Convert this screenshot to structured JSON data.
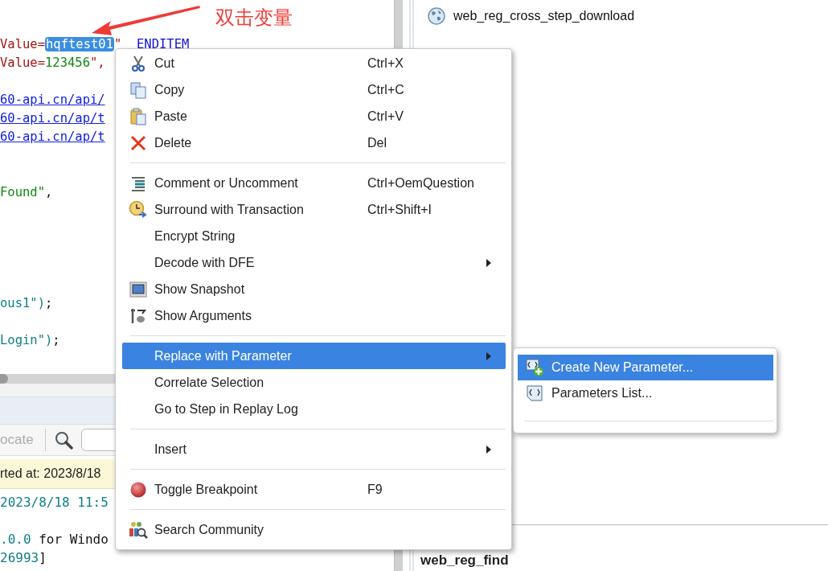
{
  "annotation": {
    "label": "双击变量"
  },
  "editor": {
    "lines": [
      {
        "kind": "code",
        "segments": [
          {
            "kind": "attr",
            "text": "Value="
          },
          {
            "kind": "selected",
            "text": "hqftest01"
          },
          {
            "kind": "attr",
            "text": "\"  "
          },
          {
            "kind": "keyword",
            "text": "ENDITEM"
          }
        ]
      },
      {
        "kind": "code",
        "segments": [
          {
            "kind": "attr",
            "text": "Value="
          },
          {
            "kind": "string",
            "text": "123456"
          },
          {
            "kind": "attr",
            "text": "\","
          }
        ]
      },
      {
        "kind": "blank"
      },
      {
        "kind": "code",
        "segments": [
          {
            "kind": "link",
            "text": "60-api.cn/api/"
          }
        ]
      },
      {
        "kind": "code",
        "segments": [
          {
            "kind": "link",
            "text": "60-api.cn/ap/t"
          }
        ]
      },
      {
        "kind": "code",
        "segments": [
          {
            "kind": "link",
            "text": "60-api.cn/ap/t"
          }
        ]
      },
      {
        "kind": "blank"
      },
      {
        "kind": "blank"
      },
      {
        "kind": "code",
        "segments": [
          {
            "kind": "string",
            "text": "Found\""
          },
          {
            "kind": "plain",
            "text": ","
          }
        ]
      },
      {
        "kind": "blank"
      },
      {
        "kind": "blank"
      },
      {
        "kind": "blank"
      },
      {
        "kind": "blank"
      },
      {
        "kind": "blank"
      },
      {
        "kind": "code",
        "segments": [
          {
            "kind": "teal",
            "text": "ous1\")"
          },
          {
            "kind": "plain",
            "text": ";"
          }
        ]
      },
      {
        "kind": "blank"
      },
      {
        "kind": "code",
        "segments": [
          {
            "kind": "teal",
            "text": "Login\")"
          },
          {
            "kind": "plain",
            "text": ";"
          }
        ]
      }
    ]
  },
  "output": {
    "locate_button": "ocate",
    "status": "rted at: 2023/8/18",
    "lines": [
      {
        "kind": "code",
        "segments": [
          {
            "kind": "teal",
            "text": "2023/8/18 11:5"
          }
        ]
      },
      {
        "kind": "blank"
      },
      {
        "kind": "code",
        "segments": [
          {
            "kind": "teal",
            "text": ".0.0"
          },
          {
            "kind": "plain",
            "text": " for Windo"
          }
        ]
      },
      {
        "kind": "code",
        "segments": [
          {
            "kind": "teal",
            "text": "26993"
          },
          {
            "kind": "plain",
            "text": "]"
          }
        ]
      }
    ]
  },
  "right_pane": {
    "step": "web_reg_cross_step_download",
    "help_title": "web_reg_find"
  },
  "context_menu": {
    "items": [
      {
        "kind": "item",
        "label": "Cut",
        "shortcut": "Ctrl+X",
        "submenu": false,
        "selected": false
      },
      {
        "kind": "item",
        "label": "Copy",
        "shortcut": "Ctrl+C",
        "submenu": false,
        "selected": false
      },
      {
        "kind": "item",
        "label": "Paste",
        "shortcut": "Ctrl+V",
        "submenu": false,
        "selected": false
      },
      {
        "kind": "item",
        "label": "Delete",
        "shortcut": "Del",
        "submenu": false,
        "selected": false
      },
      {
        "kind": "separator"
      },
      {
        "kind": "item",
        "label": "Comment or Uncomment",
        "shortcut": "Ctrl+OemQuestion",
        "submenu": false,
        "selected": false
      },
      {
        "kind": "item",
        "label": "Surround with Transaction",
        "shortcut": "Ctrl+Shift+I",
        "submenu": false,
        "selected": false
      },
      {
        "kind": "item",
        "label": "Encrypt String",
        "submenu": false,
        "selected": false
      },
      {
        "kind": "item",
        "label": "Decode with DFE",
        "submenu": true,
        "selected": false
      },
      {
        "kind": "item",
        "label": "Show Snapshot",
        "submenu": false,
        "selected": false
      },
      {
        "kind": "item",
        "label": "Show Arguments",
        "submenu": false,
        "selected": false
      },
      {
        "kind": "separator"
      },
      {
        "kind": "item",
        "label": "Replace with Parameter",
        "submenu": true,
        "selected": true
      },
      {
        "kind": "item",
        "label": "Correlate Selection",
        "submenu": false,
        "selected": false
      },
      {
        "kind": "item",
        "label": "Go to Step in Replay Log",
        "submenu": false,
        "selected": false
      },
      {
        "kind": "separator"
      },
      {
        "kind": "item",
        "label": "Insert",
        "submenu": true,
        "selected": false
      },
      {
        "kind": "separator"
      },
      {
        "kind": "item",
        "label": "Toggle Breakpoint",
        "shortcut": "F9",
        "submenu": false,
        "selected": false
      },
      {
        "kind": "separator"
      },
      {
        "kind": "item",
        "label": "Search Community",
        "submenu": false,
        "selected": false
      }
    ]
  },
  "submenu": {
    "items": [
      {
        "kind": "item",
        "label": "Create New Parameter...",
        "selected": true
      },
      {
        "kind": "item",
        "label": "Parameters List...",
        "selected": false
      },
      {
        "kind": "separator"
      }
    ]
  }
}
